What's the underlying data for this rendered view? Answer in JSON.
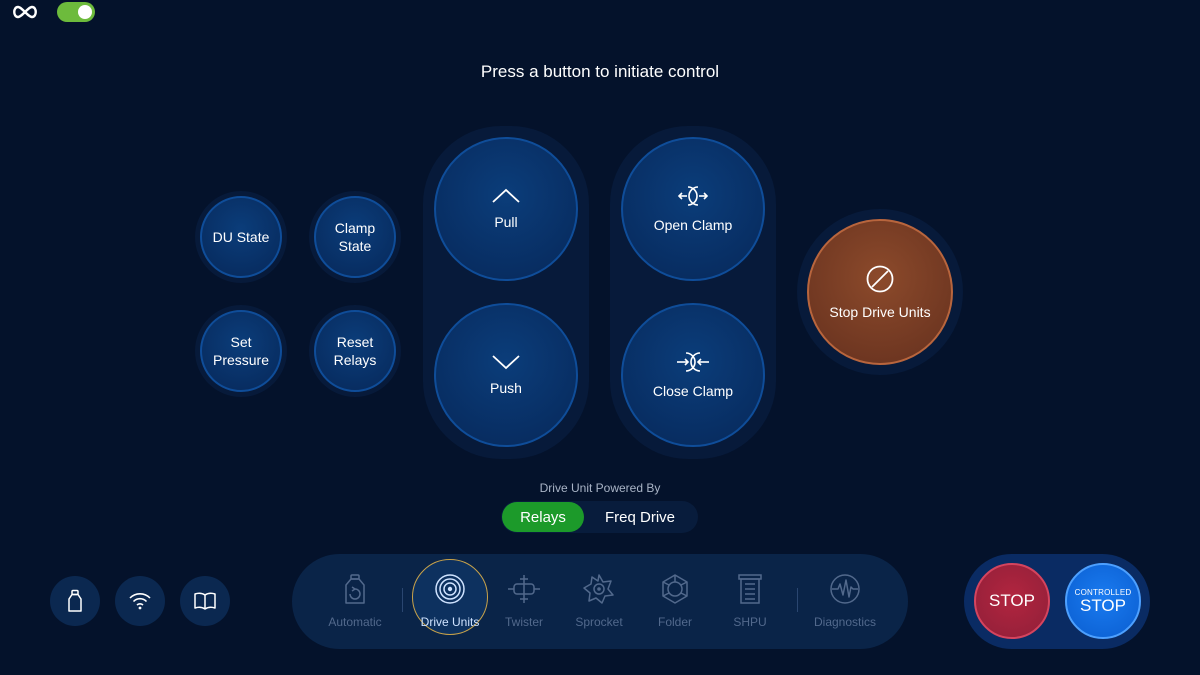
{
  "header": {
    "logo_icon": "infinity-icon",
    "toggle_state": "on",
    "toggle_color": "#6dbb3c"
  },
  "prompt": "Press a button to initiate control",
  "small_buttons": {
    "du_state": "DU State",
    "clamp_state": "Clamp\nState",
    "set_pressure": "Set\nPressure",
    "reset_relays": "Reset\nRelays"
  },
  "motion": {
    "pull": "Pull",
    "push": "Push",
    "open_clamp": "Open Clamp",
    "close_clamp": "Close Clamp"
  },
  "stop_drive_units": {
    "label": "Stop Drive Units",
    "icon": "prohibited-icon",
    "color": "#6e3621"
  },
  "powered_by": {
    "label": "Drive Unit Powered By",
    "options": [
      "Relays",
      "Freq Drive"
    ],
    "selected": "Relays",
    "selected_color": "#1c9a2a"
  },
  "quick_icons": [
    "bottle-icon",
    "wifi-icon",
    "book-icon"
  ],
  "nav": {
    "items": [
      {
        "label": "Automatic",
        "icon": "automatic-icon"
      },
      {
        "label": "Drive Units",
        "icon": "drive-units-icon",
        "active": true
      },
      {
        "label": "Twister",
        "icon": "twister-icon"
      },
      {
        "label": "Sprocket",
        "icon": "sprocket-icon"
      },
      {
        "label": "Folder",
        "icon": "folder-icon"
      },
      {
        "label": "SHPU",
        "icon": "shpu-icon"
      },
      {
        "label": "Diagnostics",
        "icon": "diagnostics-icon"
      }
    ]
  },
  "stop": {
    "stop_label": "STOP",
    "controlled_top": "CONTROLLED",
    "controlled_main": "STOP",
    "stop_color": "#96203a",
    "controlled_color": "#0d63d6"
  }
}
